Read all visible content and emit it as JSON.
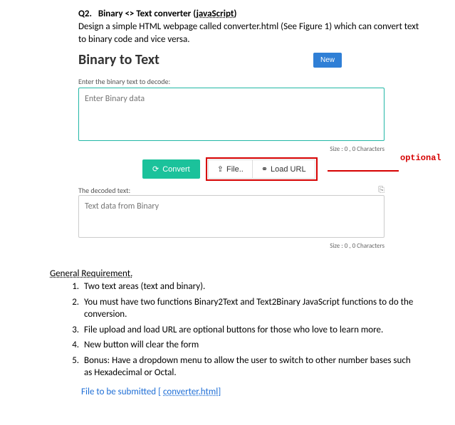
{
  "question": {
    "number": "Q2.",
    "title_part1": "Binary <> Text converter (",
    "title_js": "javaScript",
    "title_part2": ")",
    "description": "Design a simple HTML webpage called converter.html (See Figure 1) which can convert text to binary code and vice versa."
  },
  "app": {
    "title": "Binary to Text",
    "new_button": "New",
    "input_label": "Enter the binary text to decode:",
    "input_placeholder": "Enter Binary data",
    "size1": "Size : 0 , 0 Characters",
    "convert": "Convert",
    "file": "File..",
    "load_url": "Load URL",
    "optional_tag": "optional",
    "output_label": "The decoded text:",
    "output_placeholder": "Text data from Binary",
    "size2": "Size : 0 , 0 Characters"
  },
  "requirements": {
    "heading": "General Requirement.",
    "items": [
      "Two text areas (text and binary).",
      "You must have two functions Binary2Text and Text2Binary JavaScript functions to do the conversion.",
      "File upload and load URL are optional buttons for those who love to learn more.",
      "New button will clear the form",
      "Bonus: Have a dropdown menu to allow the user to switch to other number bases such as Hexadecimal or Octal."
    ],
    "submit_label": "File to be submitted [ ",
    "submit_file": "converter.html",
    "submit_end": "]"
  }
}
